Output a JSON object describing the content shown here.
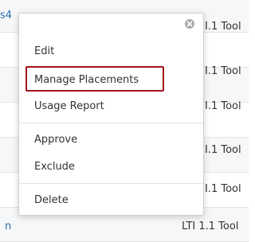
{
  "background_rows": {
    "left_fragments": [
      "s4",
      "n"
    ],
    "right_texts": [
      "I.1 Tool",
      "I.1 Tool",
      "I.1 Tool",
      "I.1 Tool",
      "I.1 Tool",
      "LTI 1.1 Tool"
    ]
  },
  "menu": {
    "close_icon": "close-circle-icon",
    "items": [
      {
        "label": "Edit"
      },
      {
        "label": "Manage Placements",
        "highlighted": true
      },
      {
        "label": "Usage Report"
      },
      {
        "label": "Approve"
      },
      {
        "label": "Exclude"
      },
      {
        "label": "Delete"
      }
    ]
  },
  "colors": {
    "highlight_border": "#a3141c",
    "link_text": "#2a6fb0"
  }
}
